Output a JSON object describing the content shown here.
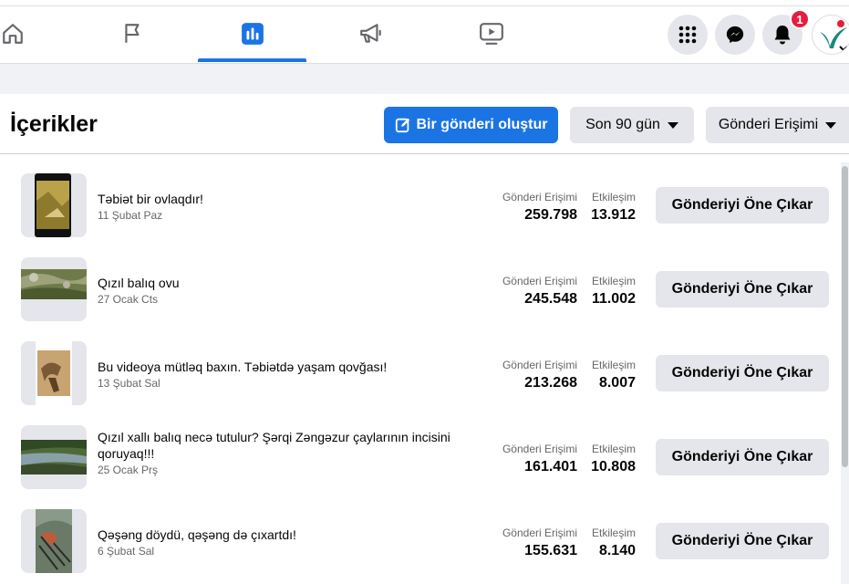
{
  "colors": {
    "accent": "#1b74e4",
    "badge": "#e41e3f",
    "button_gray": "#e4e6eb",
    "muted_text": "#65676b"
  },
  "nav": {
    "tabs": [
      {
        "icon": "home-icon"
      },
      {
        "icon": "flag-icon"
      },
      {
        "icon": "insights-icon",
        "active": true
      },
      {
        "icon": "megaphone-icon"
      },
      {
        "icon": "video-icon"
      }
    ],
    "notifications_badge": "1"
  },
  "header": {
    "title": "İçerikler",
    "create_post_label": "Bir gönderi oluştur",
    "date_range_label": "Son 90 gün",
    "metric_filter_label": "Gönderi Erişimi"
  },
  "posts": [
    {
      "title": "Təbiət bir ovlaqdır!",
      "date": "11 Şubat Paz",
      "reach_label": "Gönderi Erişimi",
      "reach": "259.798",
      "engagement_label": "Etkileşim",
      "engagement": "13.912",
      "boost_label": "Gönderiyi Öne Çıkar"
    },
    {
      "title": "Qızıl balıq ovu",
      "date": "27 Ocak Cts",
      "reach_label": "Gönderi Erişimi",
      "reach": "245.548",
      "engagement_label": "Etkileşim",
      "engagement": "11.002",
      "boost_label": "Gönderiyi Öne Çıkar"
    },
    {
      "title": "Bu videoya mütləq baxın. Təbiətdə yaşam qovğası!",
      "date": "13 Şubat Sal",
      "reach_label": "Gönderi Erişimi",
      "reach": "213.268",
      "engagement_label": "Etkileşim",
      "engagement": "8.007",
      "boost_label": "Gönderiyi Öne Çıkar"
    },
    {
      "title": "Qızıl xallı balıq necə tutulur? Şərqi Zəngəzur çaylarının incisini qoruyaq!!!",
      "date": "25 Ocak Prş",
      "reach_label": "Gönderi Erişimi",
      "reach": "161.401",
      "engagement_label": "Etkileşim",
      "engagement": "10.808",
      "boost_label": "Gönderiyi Öne Çıkar"
    },
    {
      "title": "Qəşəng döydü, qəşəng də çıxartdı!",
      "date": "6 Şubat Sal",
      "reach_label": "Gönderi Erişimi",
      "reach": "155.631",
      "engagement_label": "Etkileşim",
      "engagement": "8.140",
      "boost_label": "Gönderiyi Öne Çıkar"
    }
  ]
}
